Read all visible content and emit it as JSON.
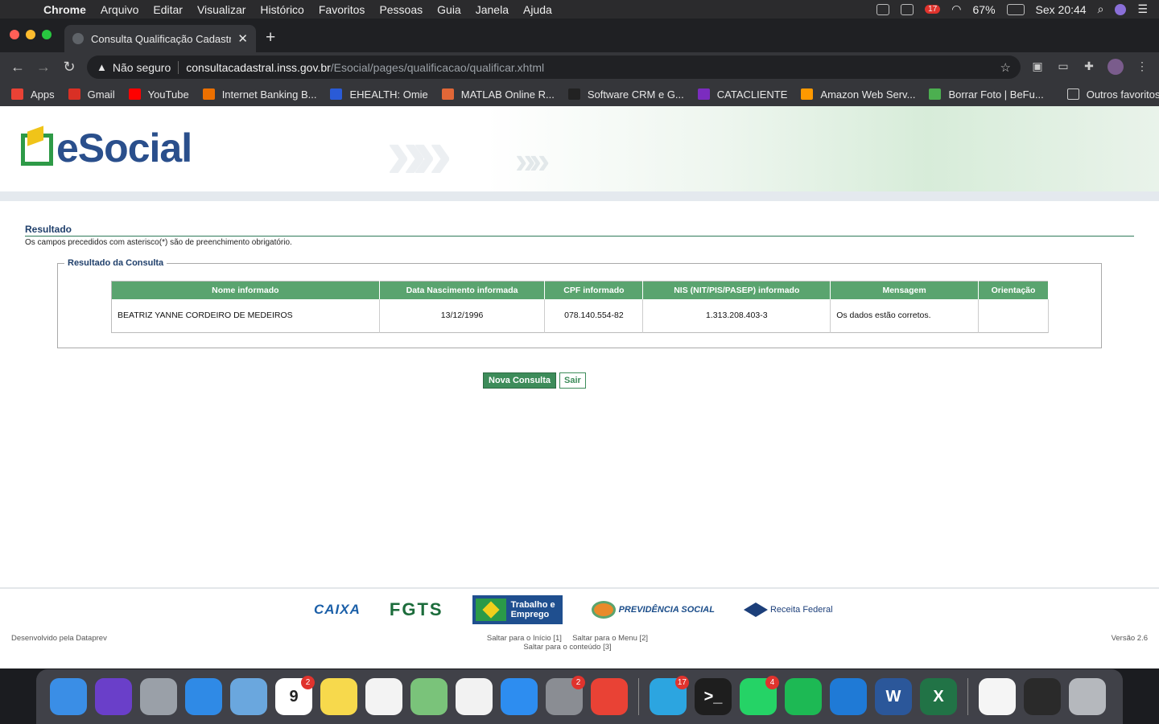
{
  "menubar": {
    "app": "Chrome",
    "items": [
      "Arquivo",
      "Editar",
      "Visualizar",
      "Histórico",
      "Favoritos",
      "Pessoas",
      "Guia",
      "Janela",
      "Ajuda"
    ],
    "battery": "67%",
    "clock": "Sex 20:44",
    "notification_badge": "17"
  },
  "tab": {
    "title": "Consulta Qualificação Cadastral",
    "close": "✕",
    "new_tab": "+"
  },
  "toolbar": {
    "back": "←",
    "forward": "→",
    "reload": "↻",
    "security_warning": "▲",
    "security_label": "Não seguro",
    "url_host": "consultacadastral.inss.gov.br",
    "url_path": "/Esocial/pages/qualificacao/qualificar.xhtml",
    "star": "☆"
  },
  "bookmarks": [
    {
      "label": "Apps",
      "color": "#e94235"
    },
    {
      "label": "Gmail",
      "color": "#d93025"
    },
    {
      "label": "YouTube",
      "color": "#ff0000"
    },
    {
      "label": "Internet Banking B...",
      "color": "#ec7000"
    },
    {
      "label": "EHEALTH: Omie",
      "color": "#2a5bd7"
    },
    {
      "label": "MATLAB Online R...",
      "color": "#e16737"
    },
    {
      "label": "Software CRM e G...",
      "color": "#222222"
    },
    {
      "label": "CATACLIENTE",
      "color": "#7b2cbf"
    },
    {
      "label": "Amazon Web Serv...",
      "color": "#ff9900"
    },
    {
      "label": "Borrar Foto | BeFu...",
      "color": "#4caf50"
    }
  ],
  "other_bookmarks": "Outros favoritos",
  "site": {
    "logo_text": "eSocial",
    "section_title": "Resultado",
    "hint": "Os campos precedidos com asterisco(*) são de preenchimento obrigatório.",
    "fieldset_legend": "Resultado da Consulta",
    "table": {
      "headers": [
        "Nome informado",
        "Data Nascimento informada",
        "CPF informado",
        "NIS (NIT/PIS/PASEP) informado",
        "Mensagem",
        "Orientação"
      ],
      "rows": [
        [
          "BEATRIZ YANNE CORDEIRO DE MEDEIROS",
          "13/12/1996",
          "078.140.554-82",
          "1.313.208.403-3",
          "Os dados estão corretos.",
          ""
        ]
      ]
    },
    "buttons": {
      "new_query": "Nova Consulta",
      "exit": "Sair"
    },
    "footer": {
      "caixa": "CAIXA",
      "fgts": "FGTS",
      "mte": "Trabalho e Emprego",
      "previdencia": "PREVIDÊNCIA SOCIAL",
      "receita": "Receita Federal",
      "developed_by": "Desenvolvido pela Dataprev",
      "skip_start": "Saltar para o Início [1]",
      "skip_menu": "Saltar para o Menu [2]",
      "skip_content": "Saltar para o conteúdo [3]",
      "version": "Versão 2.6"
    }
  },
  "dock": [
    {
      "name": "finder",
      "color": "#3a8ee6",
      "badge": ""
    },
    {
      "name": "siri",
      "color": "#6a3fc9",
      "badge": ""
    },
    {
      "name": "launchpad",
      "color": "#9aa0a8",
      "badge": ""
    },
    {
      "name": "safari",
      "color": "#2f8ae6",
      "badge": ""
    },
    {
      "name": "mail",
      "color": "#6aa7de",
      "badge": ""
    },
    {
      "name": "calendar",
      "color": "#ffffff",
      "badge": "2",
      "text": "9"
    },
    {
      "name": "notes",
      "color": "#f7d94c",
      "badge": ""
    },
    {
      "name": "reminders",
      "color": "#f3f3f3",
      "badge": ""
    },
    {
      "name": "maps",
      "color": "#7ac37a",
      "badge": ""
    },
    {
      "name": "photos",
      "color": "#f2f2f2",
      "badge": ""
    },
    {
      "name": "app-store",
      "color": "#2d8df0",
      "badge": ""
    },
    {
      "name": "system-preferences",
      "color": "#8a8d93",
      "badge": "2"
    },
    {
      "name": "chrome",
      "color": "#e94235",
      "badge": ""
    },
    {
      "name": "telegram",
      "color": "#2ca5e0",
      "badge": "17"
    },
    {
      "name": "terminal",
      "color": "#1e1e1e",
      "badge": "",
      "text": ">_"
    },
    {
      "name": "whatsapp",
      "color": "#25d366",
      "badge": "4"
    },
    {
      "name": "spotify",
      "color": "#1db954",
      "badge": ""
    },
    {
      "name": "vscode",
      "color": "#1f7ad6",
      "badge": ""
    },
    {
      "name": "word",
      "color": "#2b579a",
      "badge": "",
      "text": "W"
    },
    {
      "name": "excel",
      "color": "#217346",
      "badge": "",
      "text": "X"
    },
    {
      "name": "pdf-document",
      "color": "#f5f5f5",
      "badge": ""
    },
    {
      "name": "terminal-window",
      "color": "#2a2a2a",
      "badge": ""
    },
    {
      "name": "trash",
      "color": "#b5b8bd",
      "badge": ""
    }
  ]
}
